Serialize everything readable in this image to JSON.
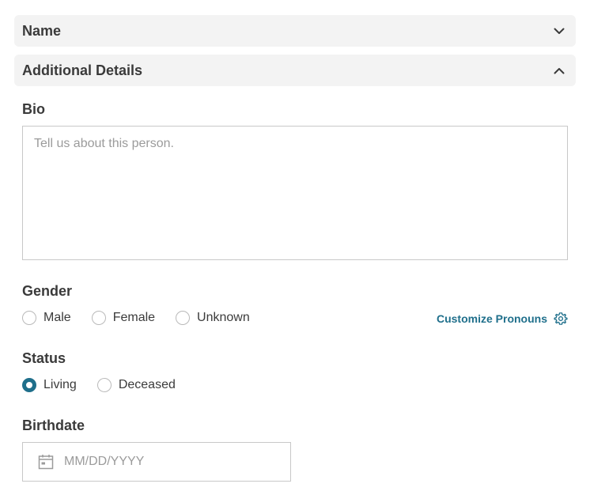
{
  "sections": {
    "name": {
      "title": "Name",
      "expanded": false,
      "icon": "chevron-down-icon"
    },
    "additional": {
      "title": "Additional Details",
      "expanded": true,
      "icon": "chevron-up-icon"
    }
  },
  "bio": {
    "label": "Bio",
    "value": "",
    "placeholder": "Tell us about this person."
  },
  "gender": {
    "label": "Gender",
    "options": [
      "Male",
      "Female",
      "Unknown"
    ],
    "selected": null,
    "customize_label": "Customize Pronouns",
    "customize_icon": "gear-icon"
  },
  "status": {
    "label": "Status",
    "options": [
      "Living",
      "Deceased"
    ],
    "selected": "Living"
  },
  "birthdate": {
    "label": "Birthdate",
    "value": "",
    "placeholder": "MM/DD/YYYY",
    "icon": "calendar-icon"
  },
  "colors": {
    "accent": "#1f6f8b",
    "panel_bg": "#f3f3f3",
    "border": "#c8c8c8",
    "placeholder": "#9b9b9b"
  }
}
